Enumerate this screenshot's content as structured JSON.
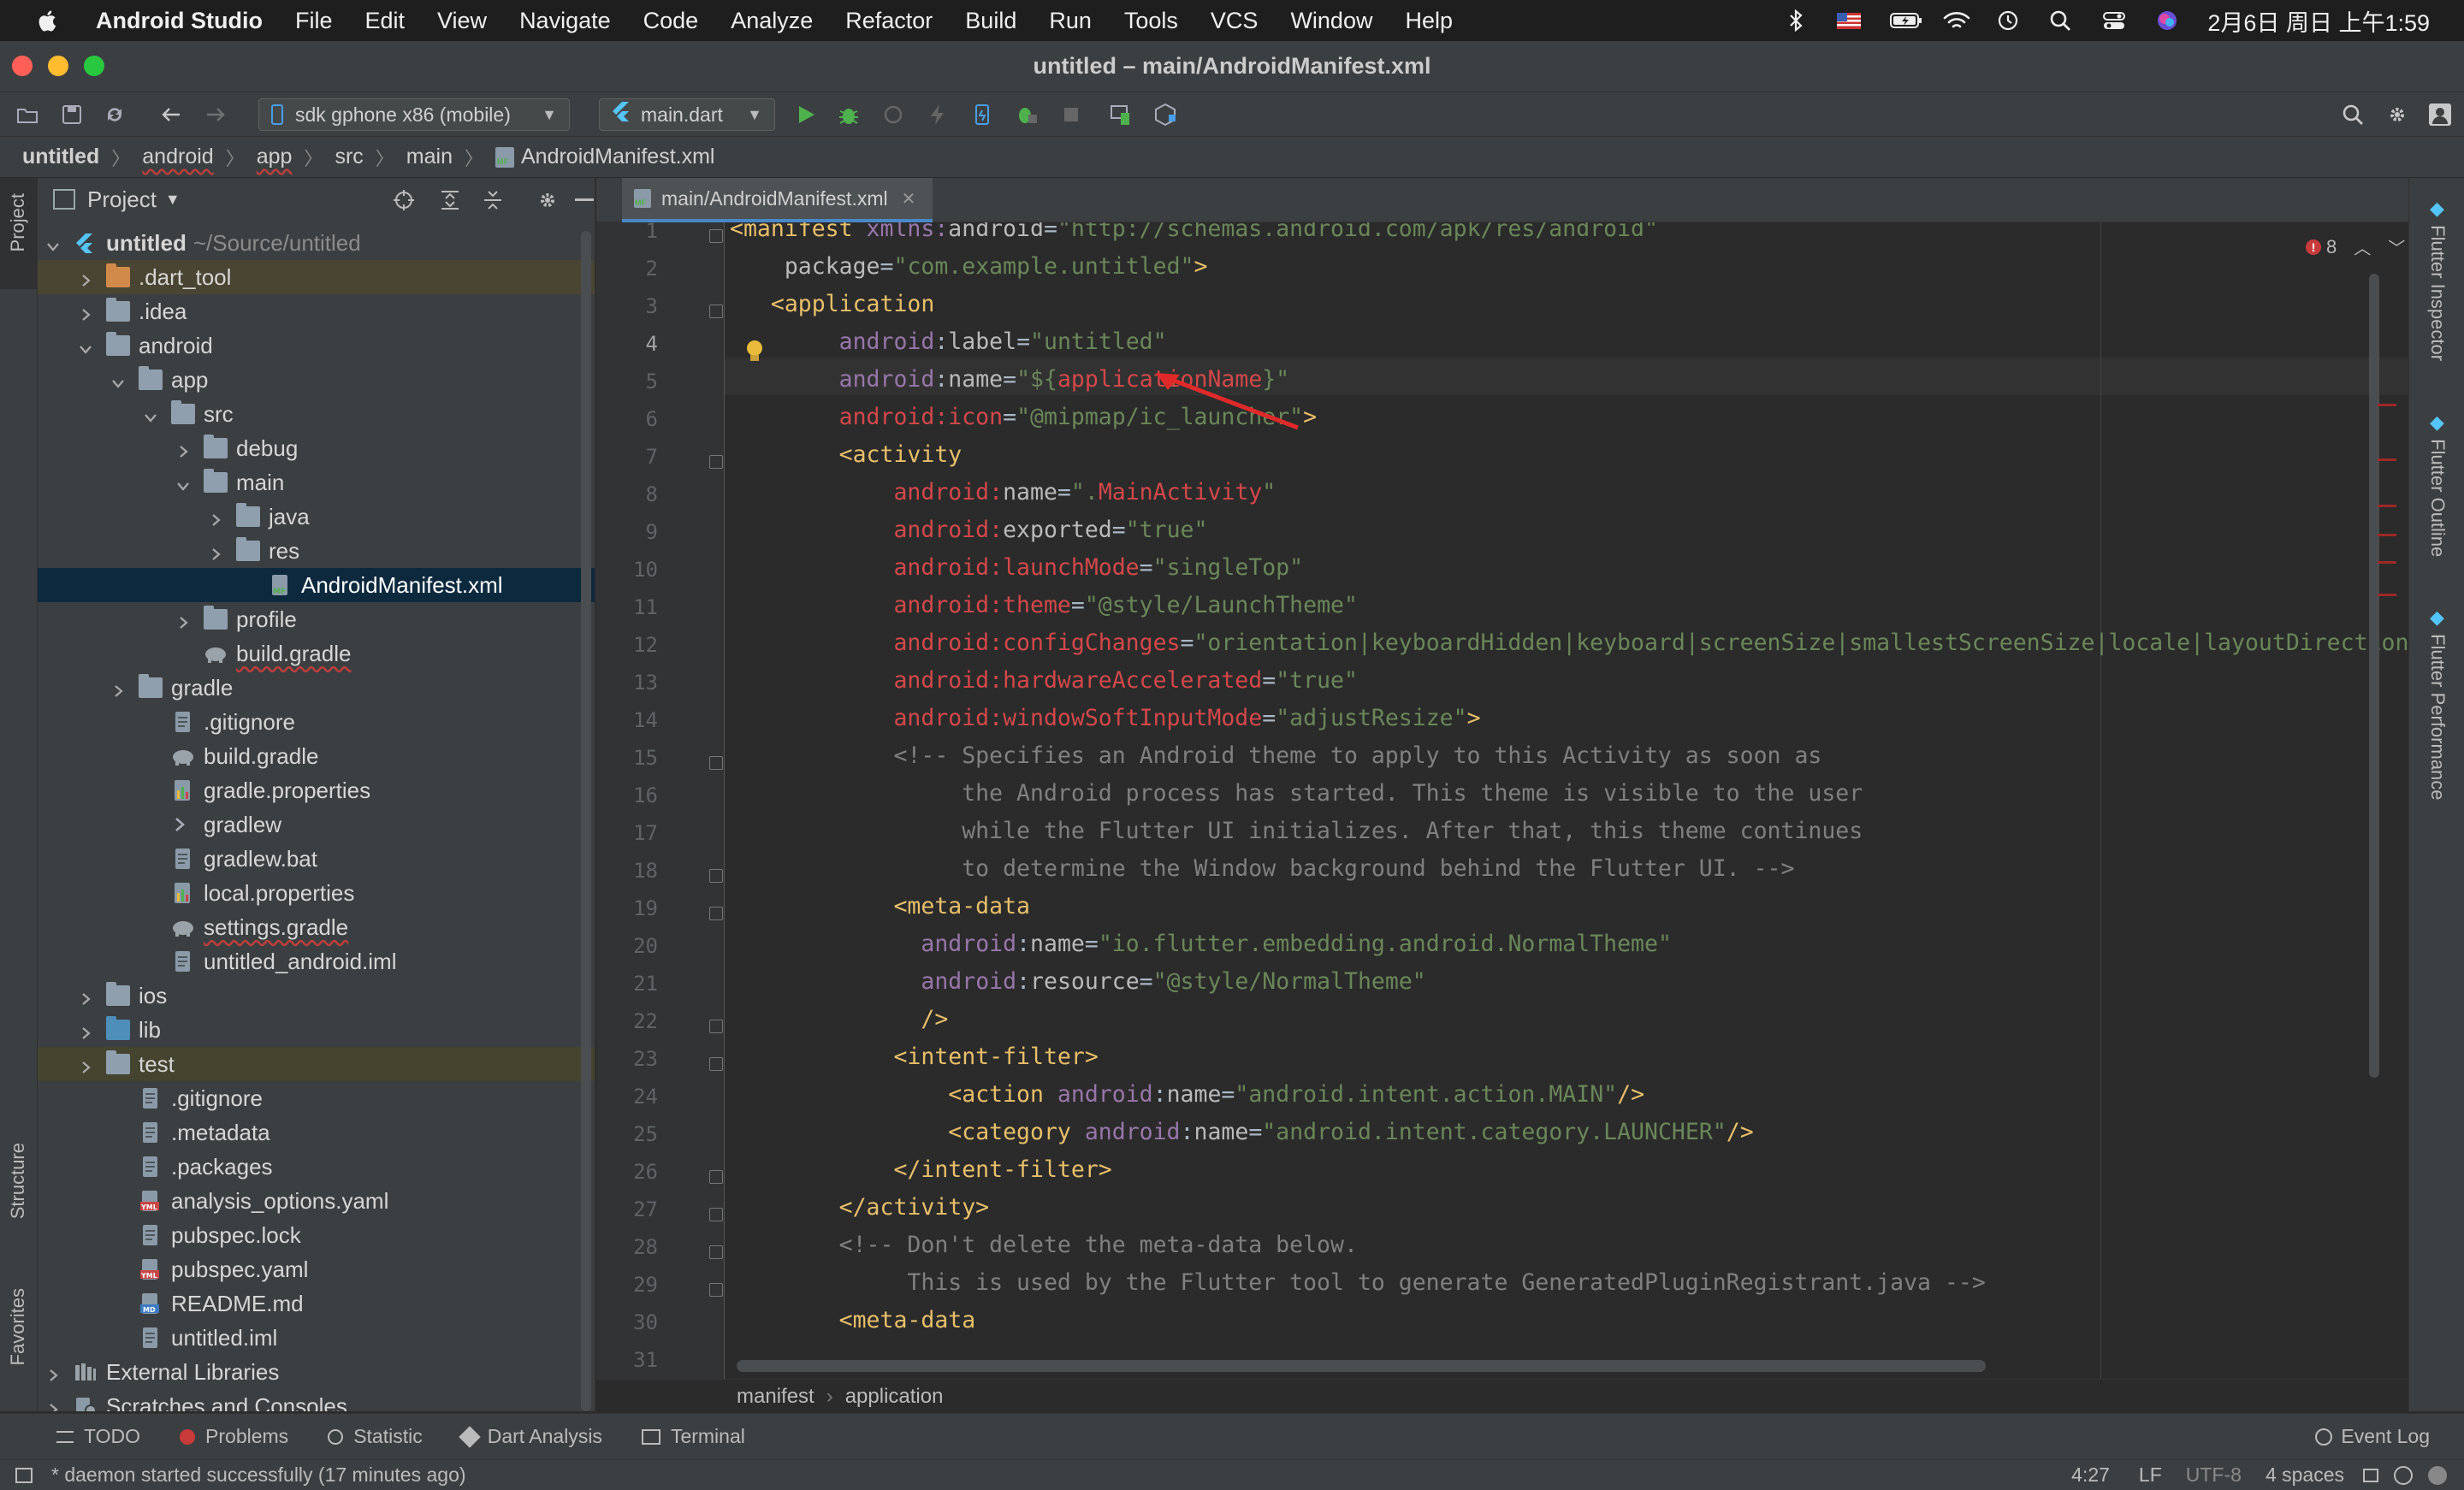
{
  "menubar": {
    "items": [
      "Android Studio",
      "File",
      "Edit",
      "View",
      "Navigate",
      "Code",
      "Analyze",
      "Refactor",
      "Build",
      "Run",
      "Tools",
      "VCS",
      "Window",
      "Help"
    ],
    "clock": "2月6日 周日 上午1:59"
  },
  "window": {
    "title": "untitled – main/AndroidManifest.xml"
  },
  "toolbar": {
    "device": "sdk gphone x86 (mobile)",
    "run_config": "main.dart"
  },
  "breadcrumb": [
    "untitled",
    "android",
    "app",
    "src",
    "main",
    "AndroidManifest.xml"
  ],
  "project_panel": {
    "title": "Project",
    "tree": [
      {
        "label": "untitled",
        "suffix": "~/Source/untitled",
        "depth": 0,
        "arrow": "down",
        "icon": "module",
        "bold": true
      },
      {
        "label": ".dart_tool",
        "depth": 1,
        "arrow": "right",
        "icon": "folder-orange"
      },
      {
        "label": ".idea",
        "depth": 1,
        "arrow": "right",
        "icon": "folder"
      },
      {
        "label": "android",
        "depth": 1,
        "arrow": "down",
        "icon": "folder"
      },
      {
        "label": "app",
        "depth": 2,
        "arrow": "down",
        "icon": "folder"
      },
      {
        "label": "src",
        "depth": 3,
        "arrow": "down",
        "icon": "folder"
      },
      {
        "label": "debug",
        "depth": 4,
        "arrow": "right",
        "icon": "folder"
      },
      {
        "label": "main",
        "depth": 4,
        "arrow": "down",
        "icon": "folder"
      },
      {
        "label": "java",
        "depth": 5,
        "arrow": "right",
        "icon": "folder"
      },
      {
        "label": "res",
        "depth": 5,
        "arrow": "right",
        "icon": "folder"
      },
      {
        "label": "AndroidManifest.xml",
        "depth": 6,
        "arrow": "none",
        "icon": "manifest",
        "selected": true
      },
      {
        "label": "profile",
        "depth": 4,
        "arrow": "right",
        "icon": "folder"
      },
      {
        "label": "build.gradle",
        "depth": 4,
        "arrow": "none",
        "icon": "gradle",
        "underline": true
      },
      {
        "label": "gradle",
        "depth": 2,
        "arrow": "right",
        "icon": "folder"
      },
      {
        "label": ".gitignore",
        "depth": 3,
        "arrow": "none",
        "icon": "file"
      },
      {
        "label": "build.gradle",
        "depth": 3,
        "arrow": "none",
        "icon": "gradle"
      },
      {
        "label": "gradle.properties",
        "depth": 3,
        "arrow": "none",
        "icon": "props"
      },
      {
        "label": "gradlew",
        "depth": 3,
        "arrow": "none",
        "icon": "exec"
      },
      {
        "label": "gradlew.bat",
        "depth": 3,
        "arrow": "none",
        "icon": "file"
      },
      {
        "label": "local.properties",
        "depth": 3,
        "arrow": "none",
        "icon": "props"
      },
      {
        "label": "settings.gradle",
        "depth": 3,
        "arrow": "none",
        "icon": "gradle",
        "underline": true
      },
      {
        "label": "untitled_android.iml",
        "depth": 3,
        "arrow": "none",
        "icon": "file"
      },
      {
        "label": "ios",
        "depth": 1,
        "arrow": "right",
        "icon": "folder"
      },
      {
        "label": "lib",
        "depth": 1,
        "arrow": "right",
        "icon": "folder-blue"
      },
      {
        "label": "test",
        "depth": 1,
        "arrow": "right",
        "icon": "folder-test",
        "highlight": true
      },
      {
        "label": ".gitignore",
        "depth": 2,
        "arrow": "none",
        "icon": "file"
      },
      {
        "label": ".metadata",
        "depth": 2,
        "arrow": "none",
        "icon": "file"
      },
      {
        "label": ".packages",
        "depth": 2,
        "arrow": "none",
        "icon": "file"
      },
      {
        "label": "analysis_options.yaml",
        "depth": 2,
        "arrow": "none",
        "icon": "yaml"
      },
      {
        "label": "pubspec.lock",
        "depth": 2,
        "arrow": "none",
        "icon": "file"
      },
      {
        "label": "pubspec.yaml",
        "depth": 2,
        "arrow": "none",
        "icon": "yaml"
      },
      {
        "label": "README.md",
        "depth": 2,
        "arrow": "none",
        "icon": "md"
      },
      {
        "label": "untitled.iml",
        "depth": 2,
        "arrow": "none",
        "icon": "file"
      },
      {
        "label": "External Libraries",
        "depth": 0,
        "arrow": "right",
        "icon": "libs"
      },
      {
        "label": "Scratches and Consoles",
        "depth": 0,
        "arrow": "right",
        "icon": "scratch"
      }
    ]
  },
  "left_strip": {
    "project": "Project",
    "structure": "Structure",
    "favorites": "Favorites"
  },
  "editor": {
    "tab": "main/AndroidManifest.xml",
    "error_count": "8",
    "lines": [
      [
        [
          "tg",
          "<manifest "
        ],
        [
          "ns",
          "xmlns:"
        ],
        [
          "at",
          "android"
        ],
        [
          "tx",
          "="
        ],
        [
          "st",
          "\"http://schemas.android.com/apk/res/android\""
        ]
      ],
      [
        [
          "tx",
          "    "
        ],
        [
          "at",
          "package"
        ],
        [
          "tx",
          "="
        ],
        [
          "st",
          "\"com.example.untitled\""
        ],
        [
          "tg",
          ">"
        ]
      ],
      [
        [
          "tx",
          "   "
        ],
        [
          "tg",
          "<application"
        ]
      ],
      [
        [
          "tx",
          "        "
        ],
        [
          "ns",
          "android"
        ],
        [
          "tx",
          ":"
        ],
        [
          "at",
          "label"
        ],
        [
          "tx",
          "="
        ],
        [
          "st",
          "\"untitled\""
        ]
      ],
      [
        [
          "tx",
          "        "
        ],
        [
          "ns",
          "android"
        ],
        [
          "tx",
          ":"
        ],
        [
          "at",
          "name"
        ],
        [
          "tx",
          "="
        ],
        [
          "st",
          "\"${"
        ],
        [
          "red",
          "applicationName"
        ],
        [
          "st",
          "}\""
        ]
      ],
      [
        [
          "tx",
          "        "
        ],
        [
          "red",
          "android:icon"
        ],
        [
          "tx",
          "="
        ],
        [
          "st",
          "\"@mipmap/ic_launcher\""
        ],
        [
          "tg",
          ">"
        ]
      ],
      [
        [
          "tx",
          "        "
        ],
        [
          "tg",
          "<activity"
        ]
      ],
      [
        [
          "tx",
          "            "
        ],
        [
          "red",
          "android:"
        ],
        [
          "at",
          "name"
        ],
        [
          "tx",
          "="
        ],
        [
          "st",
          "\"."
        ],
        [
          "red",
          "MainActivity"
        ],
        [
          "st",
          "\""
        ]
      ],
      [
        [
          "tx",
          "            "
        ],
        [
          "red",
          "android:"
        ],
        [
          "at",
          "exported"
        ],
        [
          "tx",
          "="
        ],
        [
          "st",
          "\"true\""
        ]
      ],
      [
        [
          "tx",
          "            "
        ],
        [
          "red",
          "android:launchMode"
        ],
        [
          "tx",
          "="
        ],
        [
          "st",
          "\"singleTop\""
        ]
      ],
      [
        [
          "tx",
          "            "
        ],
        [
          "red",
          "android:theme"
        ],
        [
          "tx",
          "="
        ],
        [
          "st",
          "\"@style/LaunchTheme\""
        ]
      ],
      [
        [
          "tx",
          "            "
        ],
        [
          "red",
          "android:configChanges"
        ],
        [
          "tx",
          "="
        ],
        [
          "st",
          "\"orientation|keyboardHidden|keyboard|screenSize|smallestScreenSize|locale|layoutDirection|"
        ]
      ],
      [
        [
          "tx",
          "            "
        ],
        [
          "red",
          "android:hardwareAccelerated"
        ],
        [
          "tx",
          "="
        ],
        [
          "st",
          "\"true\""
        ]
      ],
      [
        [
          "tx",
          "            "
        ],
        [
          "red",
          "android:windowSoftInputMode"
        ],
        [
          "tx",
          "="
        ],
        [
          "st",
          "\"adjustResize\""
        ],
        [
          "tg",
          ">"
        ]
      ],
      [
        [
          "tx",
          "            "
        ],
        [
          "cm",
          "<!-- Specifies an Android theme to apply to this Activity as soon as"
        ]
      ],
      [
        [
          "cm",
          "                 the Android process has started. This theme is visible to the user"
        ]
      ],
      [
        [
          "cm",
          "                 while the Flutter UI initializes. After that, this theme continues"
        ]
      ],
      [
        [
          "cm",
          "                 to determine the Window background behind the Flutter UI. -->"
        ]
      ],
      [
        [
          "tx",
          "            "
        ],
        [
          "tg",
          "<meta-data"
        ]
      ],
      [
        [
          "tx",
          "              "
        ],
        [
          "ns",
          "android"
        ],
        [
          "tx",
          ":"
        ],
        [
          "at",
          "name"
        ],
        [
          "tx",
          "="
        ],
        [
          "st",
          "\"io.flutter.embedding.android.NormalTheme\""
        ]
      ],
      [
        [
          "tx",
          "              "
        ],
        [
          "ns",
          "android"
        ],
        [
          "tx",
          ":"
        ],
        [
          "at",
          "resource"
        ],
        [
          "tx",
          "="
        ],
        [
          "st",
          "\"@style/NormalTheme\""
        ]
      ],
      [
        [
          "tx",
          "              "
        ],
        [
          "tg",
          "/>"
        ]
      ],
      [
        [
          "tx",
          "            "
        ],
        [
          "tg",
          "<intent-filter>"
        ]
      ],
      [
        [
          "tx",
          "                "
        ],
        [
          "tg",
          "<action "
        ],
        [
          "ns",
          "android"
        ],
        [
          "tx",
          ":"
        ],
        [
          "at",
          "name"
        ],
        [
          "tx",
          "="
        ],
        [
          "st",
          "\"android.intent.action.MAIN\""
        ],
        [
          "tg",
          "/>"
        ]
      ],
      [
        [
          "tx",
          "                "
        ],
        [
          "tg",
          "<category "
        ],
        [
          "ns",
          "android"
        ],
        [
          "tx",
          ":"
        ],
        [
          "at",
          "name"
        ],
        [
          "tx",
          "="
        ],
        [
          "st",
          "\"android.intent.category.LAUNCHER\""
        ],
        [
          "tg",
          "/>"
        ]
      ],
      [
        [
          "tx",
          "            "
        ],
        [
          "tg",
          "</intent-filter>"
        ]
      ],
      [
        [
          "tx",
          "        "
        ],
        [
          "tg",
          "</activity>"
        ]
      ],
      [
        [
          "tx",
          "        "
        ],
        [
          "cm",
          "<!-- Don't delete the meta-data below."
        ]
      ],
      [
        [
          "cm",
          "             This is used by the Flutter tool to generate GeneratedPluginRegistrant.java -->"
        ]
      ],
      [
        [
          "tx",
          "        "
        ],
        [
          "tg",
          "<meta-data"
        ]
      ],
      [
        [
          "tx",
          ""
        ]
      ]
    ],
    "crumbs": [
      "manifest",
      "application"
    ]
  },
  "right_strip": [
    "Flutter Inspector",
    "Flutter Outline",
    "Flutter Performance"
  ],
  "bottom_tools": [
    "TODO",
    "Problems",
    "Statistic",
    "Dart Analysis",
    "Terminal"
  ],
  "event_log": "Event Log",
  "status": {
    "message": "* daemon started successfully (17 minutes ago)",
    "position": "4:27",
    "line_sep": "LF",
    "encoding": "UTF-8",
    "indent": "4 spaces"
  },
  "colors": {
    "accent": "#4a88c7",
    "selection": "#0d293e",
    "error": "#bc3f3c",
    "tag": "#e8bf6a",
    "string": "#6a8759"
  }
}
